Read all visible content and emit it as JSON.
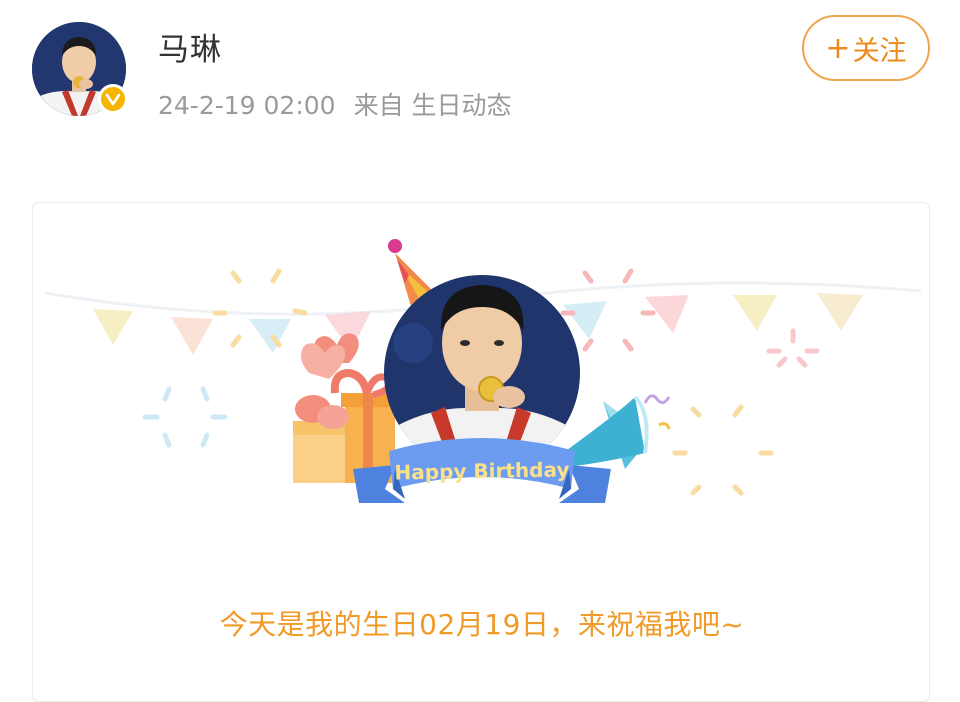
{
  "post": {
    "author": {
      "name": "马琳",
      "verified": true
    },
    "meta": {
      "time": "24-2-19 02:00",
      "source": "来自 生日动态"
    },
    "follow_label": "关注"
  },
  "card": {
    "banner_text": "Happy Birthday",
    "message": "今天是我的生日02月19日，来祝福我吧~"
  },
  "colors": {
    "accent": "#f19a27",
    "follow": "#ee8a1c",
    "badge": "#f7b500",
    "ribbon": "#5b8ee8"
  }
}
